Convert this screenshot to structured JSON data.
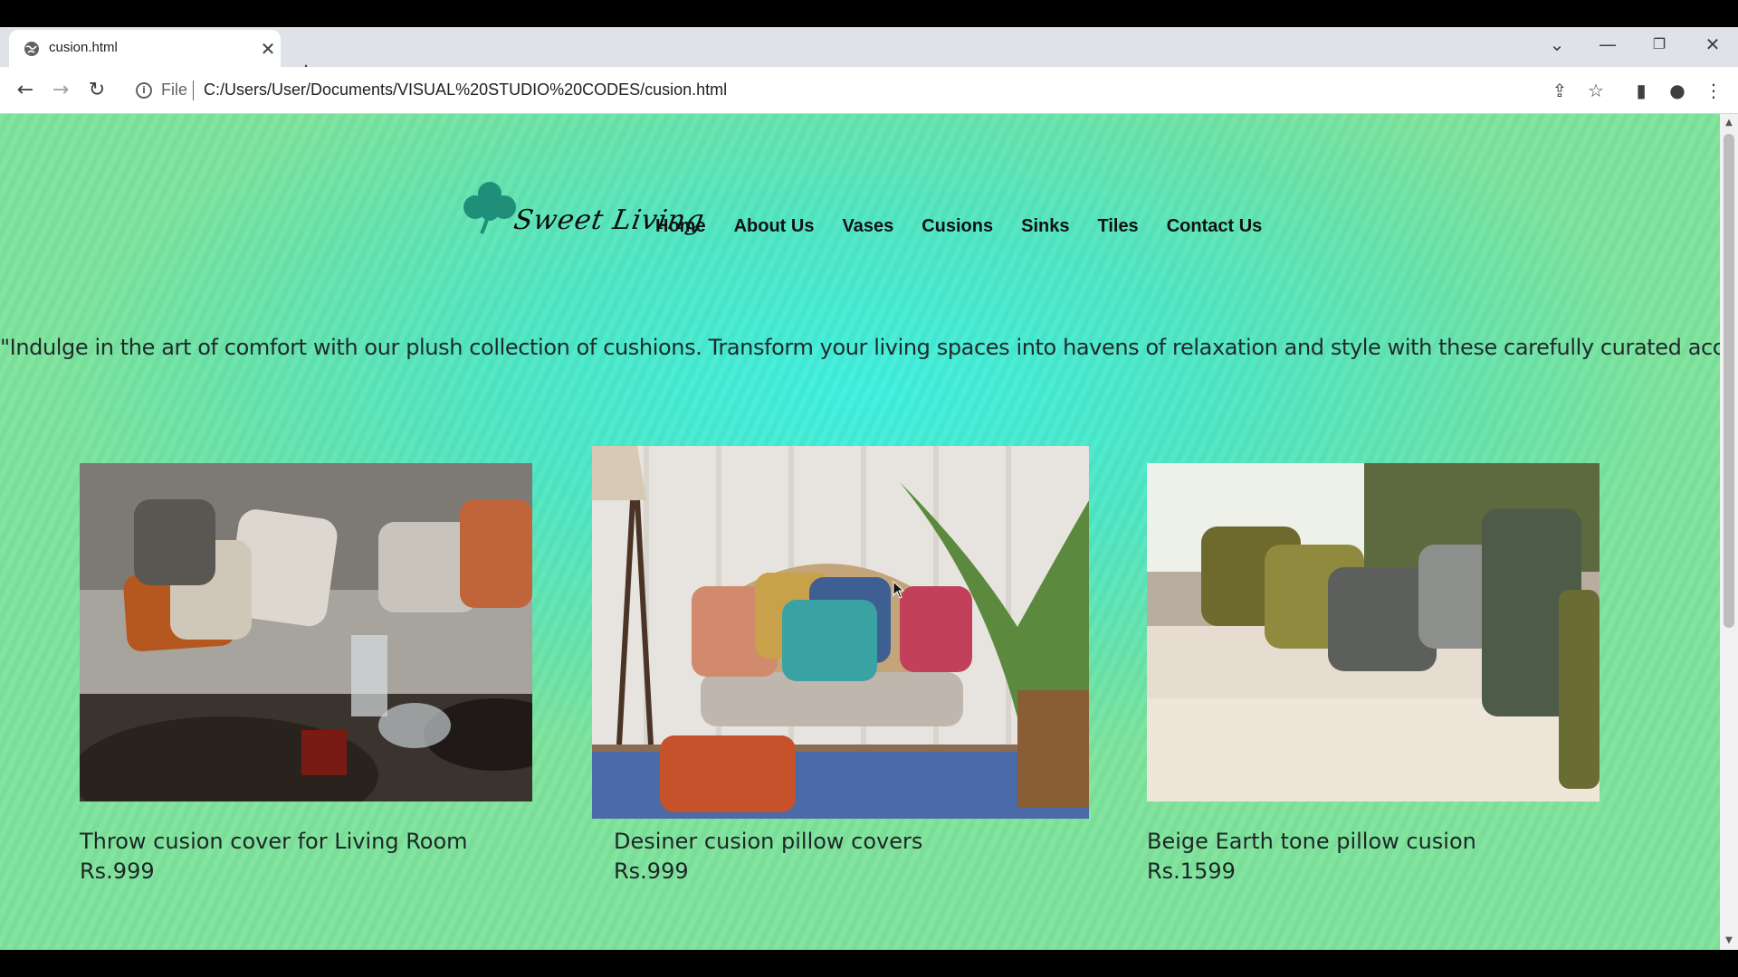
{
  "browser": {
    "tab_title": "cusion.html",
    "address_scheme": "File",
    "address_url": "C:/Users/User/Documents/VISUAL%20STUDIO%20CODES/cusion.html"
  },
  "site": {
    "brand": "Sweet Living",
    "nav": [
      "Home",
      "About Us",
      "Vases",
      "Cusions",
      "Sinks",
      "Tiles",
      "Contact Us"
    ],
    "quote": "\"Indulge in the art of comfort with our plush collection of cushions. Transform your living spaces into havens of relaxation and style with these carefully curated accents.\""
  },
  "products": [
    {
      "name": "Throw cusion cover for Living Room",
      "price": "Rs.999"
    },
    {
      "name": "Desiner cusion pillow covers",
      "price": "Rs.999"
    },
    {
      "name": "Beige Earth tone pillow cusion",
      "price": "Rs.1599"
    }
  ],
  "colors": {
    "page_bg": "#4fe6c4",
    "logo_green": "#1f8f7a"
  }
}
